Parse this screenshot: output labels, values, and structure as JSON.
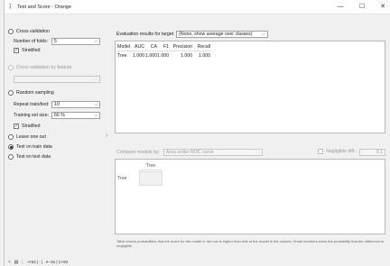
{
  "window": {
    "title": "Test and Score - Orange",
    "controls": {
      "minimize": "—",
      "maximize": "☐",
      "close": "✕"
    }
  },
  "sampling": {
    "cross_validation": "Cross validation",
    "number_of_folds_label": "Number of folds:",
    "number_of_folds_value": "5",
    "stratified_label": "Stratified",
    "cross_validation_by_feature": "Cross validation by feature",
    "random_sampling": "Random sampling",
    "repeat_label": "Repeat train/test:",
    "repeat_value": "10",
    "training_size_label": "Training set size:",
    "training_size_value": "66 %",
    "stratified2_label": "Stratified",
    "leave_one_out": "Leave one out",
    "test_on_train": "Test on train data",
    "test_on_test": "Test on test data",
    "selected": "test_on_train"
  },
  "evaluation": {
    "label": "Evaluation results for target",
    "target_value": "(None, show average over classes)",
    "columns": [
      "Model",
      "AUC",
      "CA",
      "F1",
      "Precision",
      "Recall"
    ],
    "rows": [
      [
        "Tree",
        "1.000",
        "1.000",
        "1.000",
        "1.000",
        "1.000"
      ]
    ]
  },
  "compare": {
    "label": "Compare models by:",
    "metric_value": "Area under ROC curve",
    "negligible_label": "Negligible diff.:",
    "negligible_value": "0.1",
    "column_header": "Tree",
    "row_header": "Tree",
    "footnote": "Table shows probabilities that the score for the model in the row is higher than that of the model in the column. Small numbers show the probability that the difference is negligible."
  },
  "statusbar": {
    "help_icon": "?",
    "doc_icon": "▤",
    "input_count": "92",
    "input_sep": "|",
    "input_dash": "-",
    "output_count": "92",
    "output_dims": "1×92"
  }
}
